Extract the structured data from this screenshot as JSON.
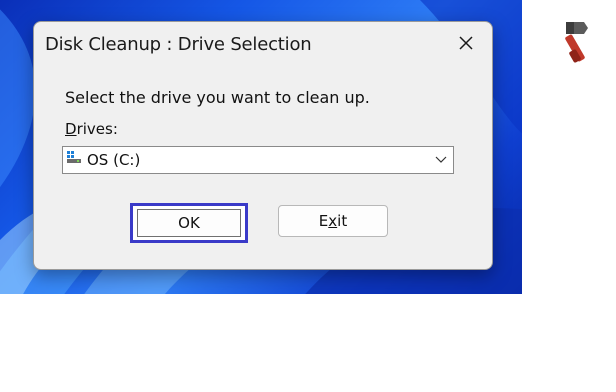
{
  "window": {
    "title": "Disk Cleanup : Drive Selection",
    "close_icon": "close-icon"
  },
  "dialog": {
    "prompt": "Select the drive you want to clean up.",
    "drives_label": "Drives:",
    "drives_label_accesskey": "D",
    "drives_label_rest": "rives:",
    "selected_drive": "OS (C:)",
    "drive_icon": "drive-icon"
  },
  "buttons": {
    "ok_label": "OK",
    "exit_label": "Exit",
    "exit_accesskey_pre": "E",
    "exit_accesskey": "x",
    "exit_accesskey_post": "it"
  },
  "colors": {
    "dialog_bg": "#f0f0f0",
    "focus_ring": "#3a3ac8",
    "wallpaper_blue": "#1557e6"
  },
  "logo": {
    "icon": "hammer-logo"
  }
}
